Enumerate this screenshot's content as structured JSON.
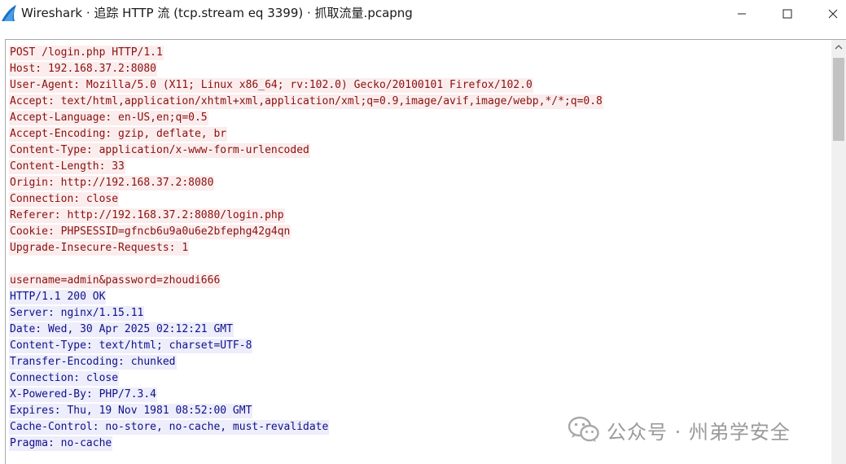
{
  "window": {
    "title": "Wireshark · 追踪 HTTP 流 (tcp.stream eq 3399) · 抓取流量.pcapng",
    "icon": "wireshark-fin-icon",
    "controls": [
      "minimize-icon",
      "maximize-icon",
      "close-icon"
    ]
  },
  "stream": {
    "client_color_bg": "#fbeded",
    "client_color_fg": "#8a1010",
    "server_color_bg": "#ededfb",
    "server_color_fg": "#10108a",
    "request_headers": [
      "POST /login.php HTTP/1.1",
      "Host: 192.168.37.2:8080",
      "User-Agent: Mozilla/5.0 (X11; Linux x86_64; rv:102.0) Gecko/20100101 Firefox/102.0",
      "Accept: text/html,application/xhtml+xml,application/xml;q=0.9,image/avif,image/webp,*/*;q=0.8",
      "Accept-Language: en-US,en;q=0.5",
      "Accept-Encoding: gzip, deflate, br",
      "Content-Type: application/x-www-form-urlencoded",
      "Content-Length: 33",
      "Origin: http://192.168.37.2:8080",
      "Connection: close",
      "Referer: http://192.168.37.2:8080/login.php",
      "Cookie: PHPSESSID=gfncb6u9a0u6e2bfephg42g4qn",
      "Upgrade-Insecure-Requests: 1"
    ],
    "request_body": "username=admin&password=zhoudi666",
    "response_headers": [
      "HTTP/1.1 200 OK",
      "Server: nginx/1.15.11",
      "Date: Wed, 30 Apr 2025 02:12:21 GMT",
      "Content-Type: text/html; charset=UTF-8",
      "Transfer-Encoding: chunked",
      "Connection: close",
      "X-Powered-By: PHP/7.3.4",
      "Expires: Thu, 19 Nov 1981 08:52:00 GMT",
      "Cache-Control: no-store, no-cache, must-revalidate",
      "Pragma: no-cache"
    ]
  },
  "watermark": {
    "text": "公众号 · 州弟学安全",
    "icon": "wechat-icon"
  }
}
